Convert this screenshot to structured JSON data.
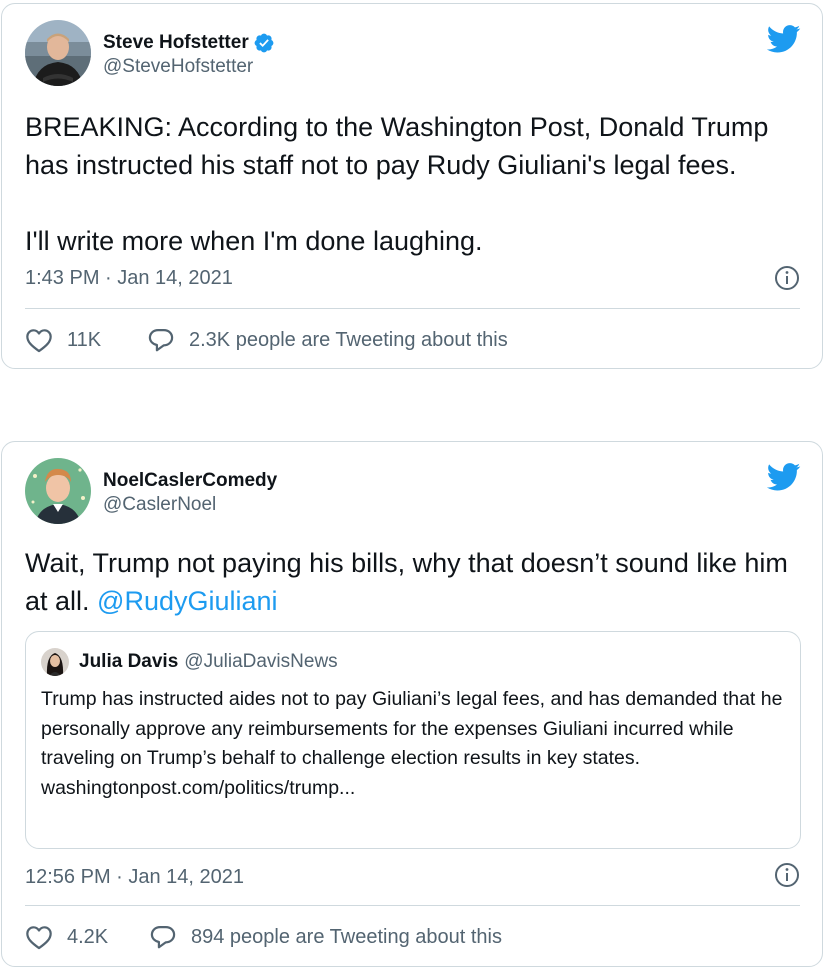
{
  "colors": {
    "accent": "#1d9bf0",
    "secondary_text": "#536471",
    "border": "#cfd9de"
  },
  "tweets": [
    {
      "author_name": "Steve Hofstetter",
      "author_handle": "@SteveHofstetter",
      "verified": true,
      "text": "BREAKING: According to the Washington Post, Donald Trump has instructed his staff not to pay Rudy Giuliani's legal fees.\n\nI'll write more when I'm done laughing.",
      "timestamp": "1:43 PM · Jan 14, 2021",
      "likes": "11K",
      "conversation": "2.3K people are Tweeting about this",
      "icons": [
        "verified-badge-icon",
        "twitter-bird-icon",
        "info-icon",
        "heart-icon",
        "speech-bubble-icon"
      ]
    },
    {
      "author_name": "NoelCaslerComedy",
      "author_handle": "@CaslerNoel",
      "text": "Wait, Trump not paying his bills, why that doesn’t sound like him at all. ",
      "mention": "@RudyGiuliani",
      "quoted": {
        "author_name": "Julia Davis",
        "author_handle": "@JuliaDavisNews",
        "text": "Trump has instructed aides not to pay Giuliani’s legal fees, and has demanded that he personally approve any reimbursements for the expenses Giuliani incurred while traveling on Trump’s behalf to challenge election results in key states.",
        "link": "washingtonpost.com/politics/trump..."
      },
      "timestamp": "12:56 PM · Jan 14, 2021",
      "likes": "4.2K",
      "conversation": "894 people are Tweeting about this",
      "icons": [
        "twitter-bird-icon",
        "info-icon",
        "heart-icon",
        "speech-bubble-icon"
      ]
    }
  ]
}
